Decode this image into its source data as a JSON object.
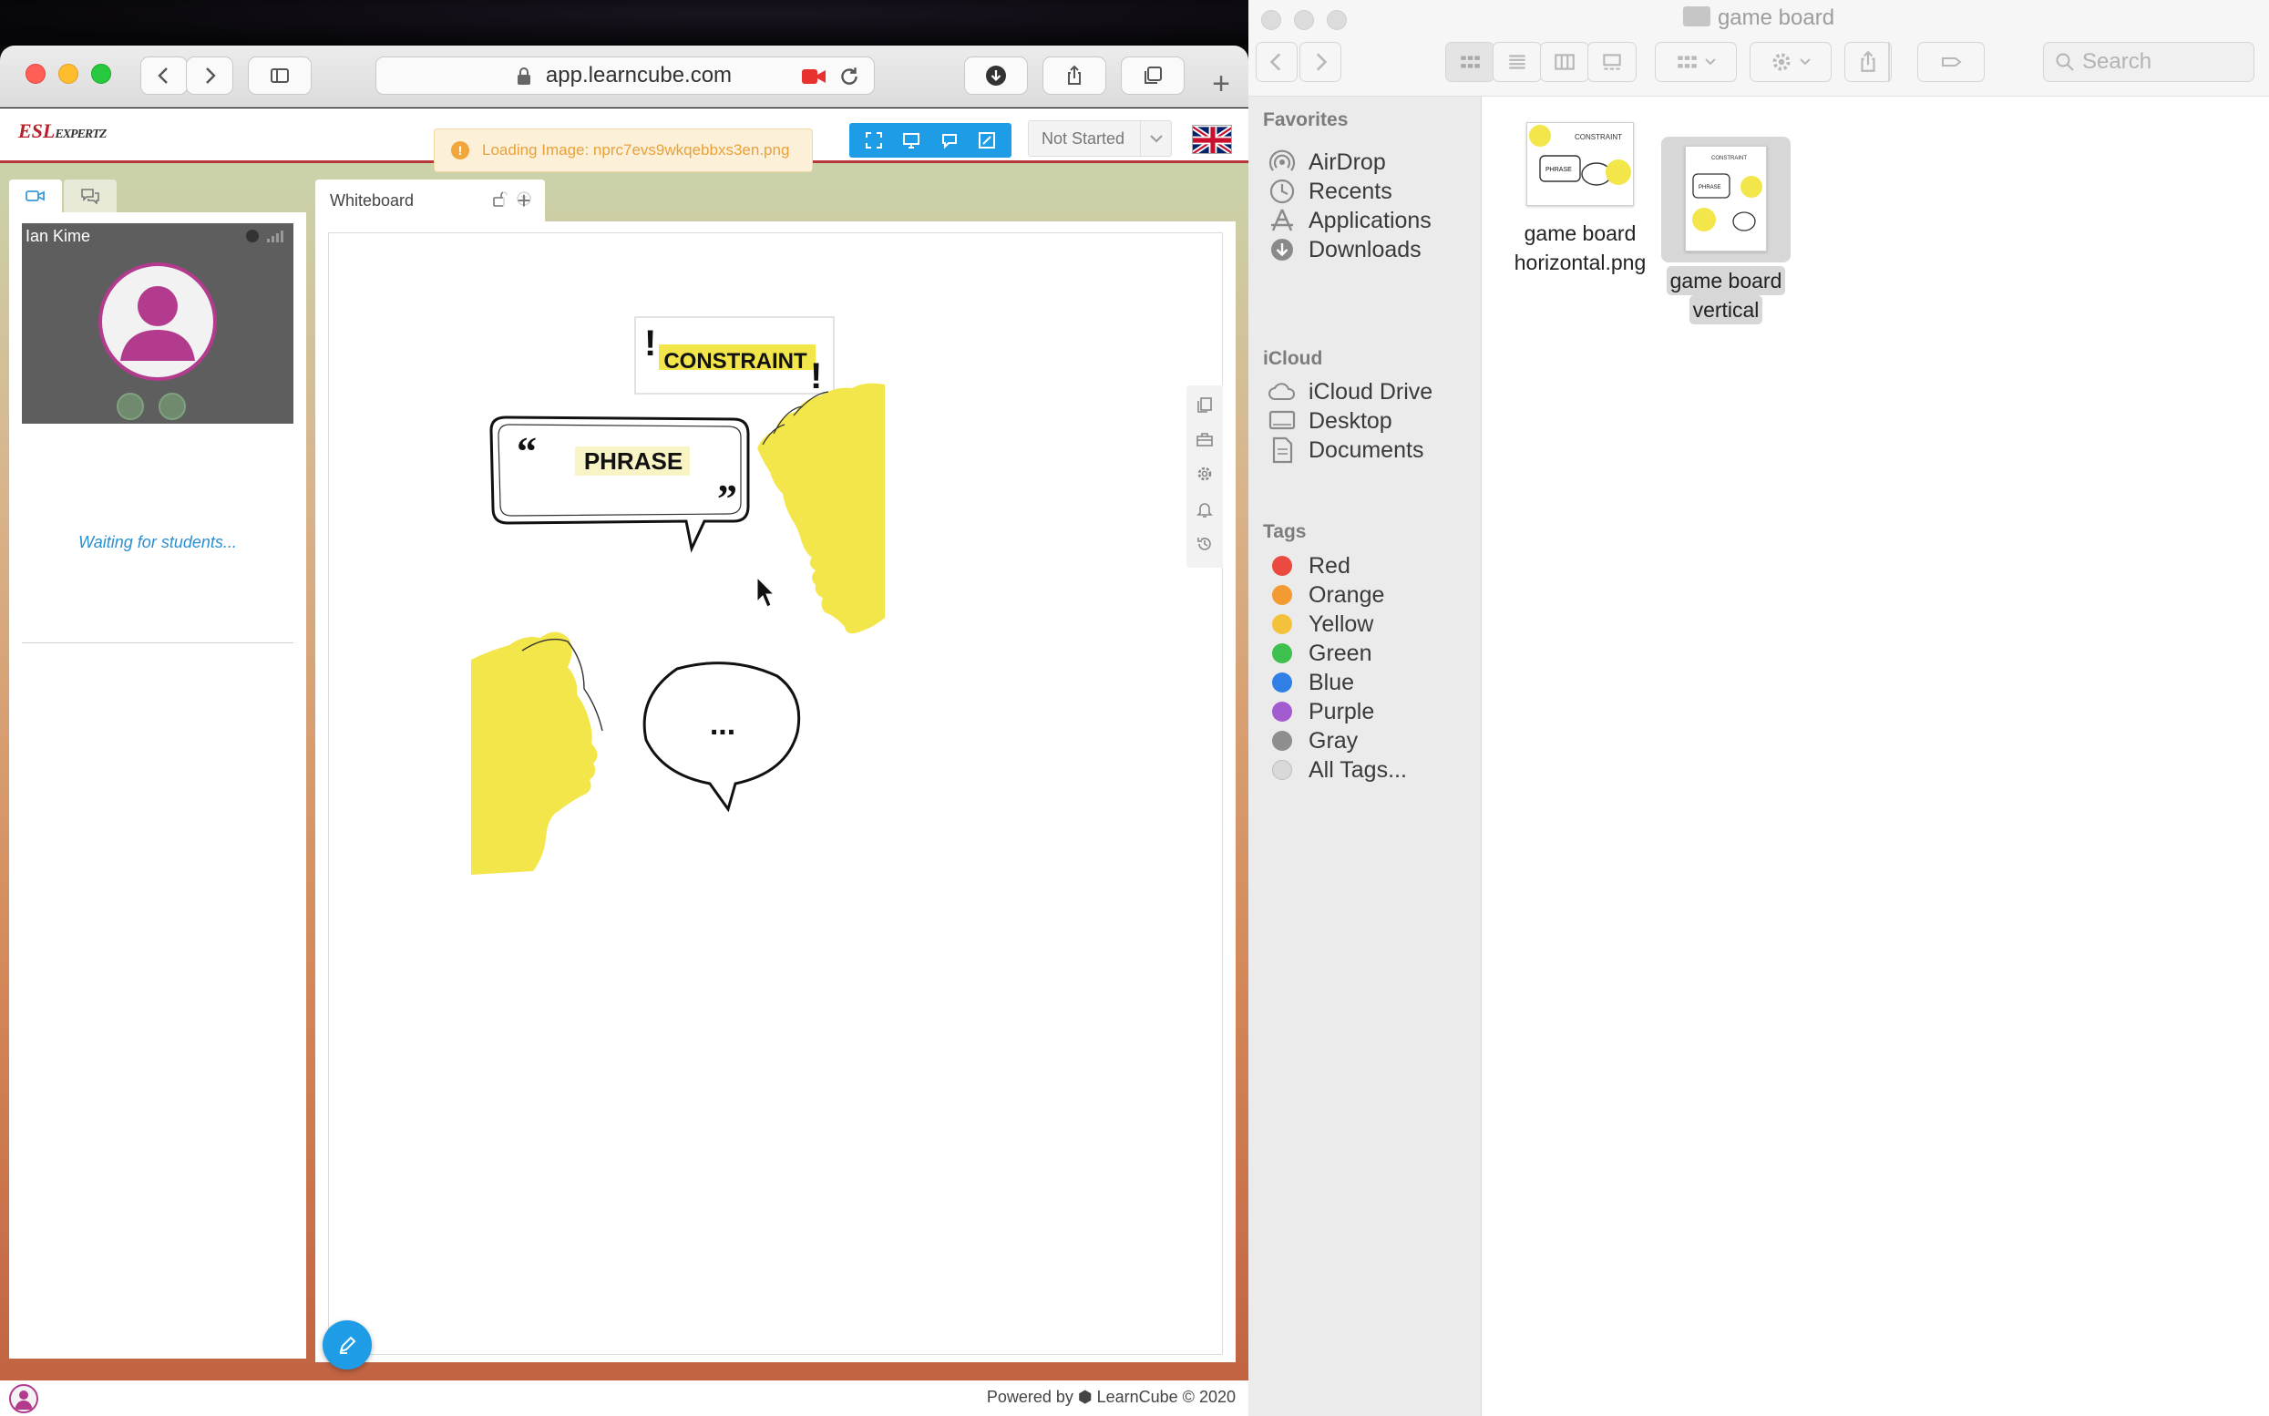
{
  "browser": {
    "url": "app.learncube.com"
  },
  "app": {
    "logo_main": "ESL",
    "logo_sub": "EXPERTZ",
    "loading_text": "Loading Image: nprc7evs9wkqebbxs3en.png",
    "status_value": "Not Started"
  },
  "video": {
    "participant_name": "Ian Kime",
    "waiting_text": "Waiting for students..."
  },
  "whiteboard": {
    "tab_label": "Whiteboard",
    "add_tab_label": "+",
    "card_constraint": "CONSTRAINT",
    "card_phrase": "PHRASE",
    "ellipsis": "...",
    "accent_yellow": "#f2e64a"
  },
  "footer": {
    "powered_by": "Powered by ⬢ LearnCube © 2020"
  },
  "finder": {
    "window_title": "game board",
    "search_placeholder": "Search",
    "favorites_heading": "Favorites",
    "favorites": [
      {
        "label": "AirDrop",
        "icon": "airdrop-icon"
      },
      {
        "label": "Recents",
        "icon": "clock-icon"
      },
      {
        "label": "Applications",
        "icon": "applications-icon"
      },
      {
        "label": "Downloads",
        "icon": "download-icon"
      }
    ],
    "icloud_heading": "iCloud",
    "icloud": [
      {
        "label": "iCloud Drive",
        "icon": "cloud-icon"
      },
      {
        "label": "Desktop",
        "icon": "desktop-icon"
      },
      {
        "label": "Documents",
        "icon": "document-icon"
      }
    ],
    "tags_heading": "Tags",
    "tags": [
      {
        "label": "Red",
        "color": "#ea4a3f"
      },
      {
        "label": "Orange",
        "color": "#f39a32"
      },
      {
        "label": "Yellow",
        "color": "#f3c23a"
      },
      {
        "label": "Green",
        "color": "#3ec04e"
      },
      {
        "label": "Blue",
        "color": "#2f7fe6"
      },
      {
        "label": "Purple",
        "color": "#a35bd0"
      },
      {
        "label": "Gray",
        "color": "#8e8e8e"
      },
      {
        "label": "All Tags...",
        "color": "#d9d9d9"
      }
    ],
    "files": [
      {
        "line1": "game board",
        "line2": "horizontal.png"
      },
      {
        "line1": "game board",
        "line2": "vertical"
      }
    ]
  }
}
